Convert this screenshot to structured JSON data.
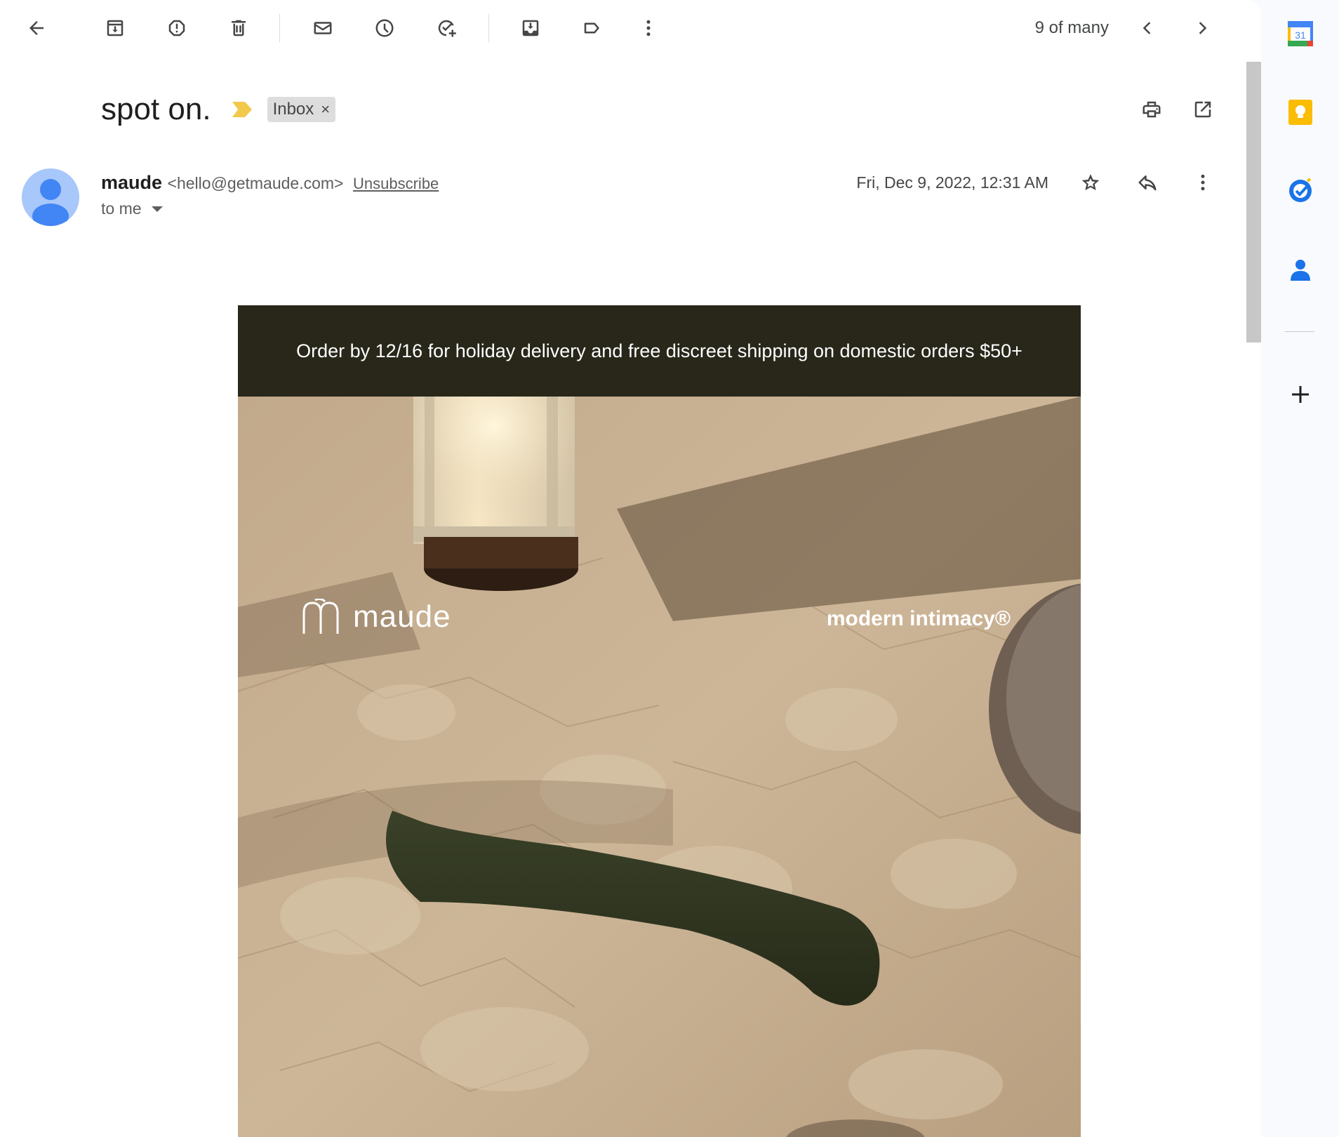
{
  "toolbar": {
    "pager_text": "9 of many",
    "icons": [
      "back-arrow-icon",
      "archive-icon",
      "report-spam-icon",
      "delete-icon",
      "mark-unread-icon",
      "snooze-icon",
      "add-task-icon",
      "move-to-icon",
      "label-icon",
      "more-vert-icon",
      "chevron-left-icon",
      "chevron-right-icon"
    ]
  },
  "message": {
    "subject": "spot on.",
    "label": "Inbox",
    "label_remove": "×",
    "sender_name": "maude",
    "sender_email": "<hello@getmaude.com>",
    "unsubscribe": "Unsubscribe",
    "to": "to me",
    "date": "Fri, Dec 9, 2022, 12:31 AM"
  },
  "email_body": {
    "banner_text": "Order by 12/16 for holiday delivery and free discreet shipping on domestic orders $50+",
    "brand_name": "maude",
    "tagline": "modern intimacy®"
  },
  "side_panel": {
    "calendar_day": "31",
    "apps": [
      "calendar-icon",
      "keep-icon",
      "tasks-icon",
      "contacts-icon",
      "add-icon"
    ]
  },
  "colors": {
    "banner_bg": "#28271a",
    "importance_marker": "#f2c94c",
    "avatar_bg": "#a8c7fa",
    "avatar_fg": "#4285f4"
  }
}
